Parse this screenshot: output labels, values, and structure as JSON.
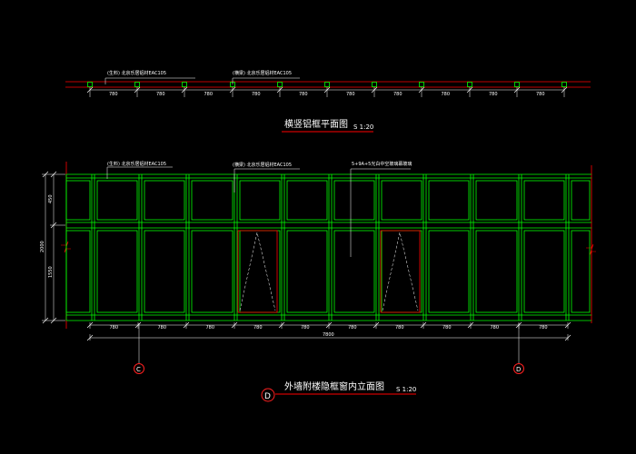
{
  "plan": {
    "label_left": "(生料) 北京乐居铝材EAC105",
    "label_mid": "(横梁) 北京乐居铝材EAC105",
    "dims": [
      "780",
      "780",
      "780",
      "780",
      "780",
      "780",
      "780",
      "780",
      "780",
      "780"
    ],
    "title": "横竖铝框平面图",
    "scale": "S 1:20"
  },
  "elevation": {
    "label_left": "(生料) 北京乐居铝材EAC105",
    "label_mid": "(横梁) 北京乐居铝材EAC105",
    "label_glass": "5+9A+5光白中空玻璃幕玻璃",
    "dims": [
      "780",
      "780",
      "780",
      "780",
      "780",
      "780",
      "780",
      "780",
      "780",
      "780"
    ],
    "total": "7800",
    "vert_dims": [
      "450",
      "1550"
    ],
    "vert_total": "2000",
    "title": "外墙附楼隐框窗内立面图",
    "scale": "S 1:20",
    "section_mark": "D",
    "grid_left": "C",
    "grid_right": "D"
  },
  "colors": {
    "background": "#000000",
    "frame": "#00ff00",
    "dims": "#ffffff",
    "red": "#ff0000",
    "marker": "#ff2020"
  }
}
